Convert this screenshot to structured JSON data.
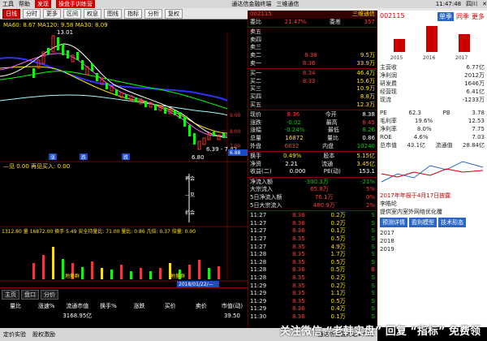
{
  "menubar": {
    "items": [
      "工具",
      "帮助",
      "发现",
      "操盘手训练营"
    ],
    "center": "通达信金融终端",
    "center2": "三维通信",
    "clock": "11:47:48",
    "region": "四川"
  },
  "toolbar": {
    "items": [
      "日线",
      "分时",
      "更多"
    ],
    "buttons": [
      "区间",
      "权息",
      "图线",
      "指标",
      "分析",
      "复权"
    ]
  },
  "chart": {
    "ma_line": "MA60: 8.67  MA120: 9.58    MA30: 8.09",
    "price_high": "13.01",
    "range_label": "6.39 - 7.42",
    "low_label": "6.80",
    "marker_labels": [
      "涨",
      "跌",
      "跌"
    ],
    "axis_labels": [
      "9.00",
      "8.00",
      "7.00",
      "6.88"
    ],
    "indicator_label": "—见  0.00  再见买入: 0.00",
    "indicator_marks": [
      "再会",
      "—见",
      "机会"
    ],
    "volume_line": "1312.80  量  16872.00  换手  5.49  安全持量比: 71.00  量比: 0.86   几倍: 0.37  倍量: 0.00",
    "bottom_labels": [
      "地量群",
      "地量群"
    ],
    "date_label": "2018/01/22/—"
  },
  "quote": {
    "code": "002115",
    "name": "三维通信",
    "weibi_label": "委比",
    "weibi": "21.47%",
    "weicha_label": "委差",
    "weicha": "357",
    "sell": [
      {
        "label": "卖五",
        "price": "",
        "vol": ""
      },
      {
        "label": "卖四",
        "price": "",
        "vol": ""
      },
      {
        "label": "卖三",
        "price": "",
        "vol": ""
      },
      {
        "label": "卖二",
        "price": "8.38",
        "vol": "9.5万"
      },
      {
        "label": "卖一",
        "price": "8.36",
        "vol": "33.9万"
      }
    ],
    "buy": [
      {
        "label": "买一",
        "price": "8.34",
        "vol": "46.4万"
      },
      {
        "label": "买二",
        "price": "8.33",
        "vol": "15.6万"
      },
      {
        "label": "买三",
        "price": "",
        "vol": "10.9万"
      },
      {
        "label": "买四",
        "price": "",
        "vol": "8.8万"
      },
      {
        "label": "买五",
        "price": "",
        "vol": "12.3万"
      }
    ],
    "stats": [
      {
        "l1": "现价",
        "v1": "8.36",
        "l2": "今开",
        "v2": "8.38"
      },
      {
        "l1": "涨跌",
        "v1": "-0.02",
        "l2": "最高",
        "v2": "8.45"
      },
      {
        "l1": "涨幅",
        "v1": "-0.24%",
        "l2": "最低",
        "v2": "8.26"
      },
      {
        "l1": "总量",
        "v1": "16872",
        "l2": "量比",
        "v2": "0.86"
      },
      {
        "l1": "外盘",
        "v1": "6632",
        "l2": "内盘",
        "v2": "10240"
      },
      {
        "l1": "换手",
        "v1": "0.49%",
        "l2": "股本",
        "v2": "5.15亿"
      },
      {
        "l1": "净资",
        "v1": "2.21",
        "l2": "流通",
        "v2": "3.45亿"
      },
      {
        "l1": "收益(二)",
        "v1": "0.000",
        "l2": "PE(动)",
        "v2": "153.1"
      }
    ],
    "flows": [
      {
        "l": "净流入额",
        "v": "-300.3万",
        "p": "-21%"
      },
      {
        "l": "大宗流入",
        "v": "65.8万",
        "p": "5%"
      },
      {
        "l": "5日净流入额",
        "v": "76.1万",
        "p": "0%"
      },
      {
        "l": "5日大宗流入",
        "v": "480.9万",
        "p": "2%"
      }
    ],
    "ticks": [
      {
        "t": "11:27",
        "p": "8.36",
        "v": "0.2万",
        "s": "S"
      },
      {
        "t": "11:27",
        "p": "8.36",
        "v": "0.2万",
        "s": "S"
      },
      {
        "t": "11:27",
        "p": "8.36",
        "v": "0.1万",
        "s": "S"
      },
      {
        "t": "11:27",
        "p": "8.35",
        "v": "0.5万",
        "s": "S"
      },
      {
        "t": "11:27",
        "p": "8.35",
        "v": "4.9万",
        "s": "S"
      },
      {
        "t": "11:28",
        "p": "8.35",
        "v": "1.7万",
        "s": "S"
      },
      {
        "t": "11:28",
        "p": "8.35",
        "v": "0.5万",
        "s": "S"
      },
      {
        "t": "11:28",
        "p": "8.36",
        "v": "0.5万",
        "s": "B"
      },
      {
        "t": "11:28",
        "p": "8.35",
        "v": "0.2万",
        "s": "S"
      },
      {
        "t": "11:29",
        "p": "8.35",
        "v": "0.2万",
        "s": "S"
      },
      {
        "t": "11:29",
        "p": "8.35",
        "v": "1.1万",
        "s": "S"
      },
      {
        "t": "11:29",
        "p": "8.35",
        "v": "0.5万",
        "s": "S"
      },
      {
        "t": "11:29",
        "p": "8.36",
        "v": "0.4万",
        "s": "S"
      },
      {
        "t": "11:30",
        "p": "8.36",
        "v": "0.1万",
        "s": "S"
      }
    ]
  },
  "info": {
    "code": "002115",
    "tabs": [
      "单季",
      "同季",
      "更多"
    ],
    "years": [
      "2015",
      "2016",
      "2017"
    ],
    "rows": [
      {
        "l": "主营收",
        "v": "6.77亿"
      },
      {
        "l": "净利润",
        "v": "2012万"
      },
      {
        "l": "研发费",
        "v": "1646万"
      },
      {
        "l": "经营现",
        "v": "6.41亿"
      },
      {
        "l": "现流",
        "v": "-1233万"
      }
    ],
    "metrics": [
      {
        "l": "PE",
        "v": "62.3",
        "l2": "PB",
        "v2": "3.78"
      },
      {
        "l": "毛利率",
        "v": "19.6%",
        "l2": "",
        "v2": "12.53"
      },
      {
        "l": "净利率",
        "v": "8.0%",
        "l2": "",
        "v2": "7.75"
      },
      {
        "l": "ROE",
        "v": "4.6%",
        "l2": "",
        "v2": "7.03"
      },
      {
        "l": "总市值",
        "v": "43.1亿",
        "l2": "流通值",
        "v2": "28.84亿"
      }
    ],
    "notice": "2017年年报于4月17日披露",
    "person": "李皓纶",
    "company": "提供室内室外网络优化覆",
    "bottom_tabs": [
      "预测详情",
      "盈利模型",
      "技术形态"
    ],
    "forecast_years": [
      "2017",
      "2018",
      "2019"
    ]
  },
  "bottom": {
    "headers": [
      "量比",
      "涨速%",
      "流通市值",
      "换手%",
      "涨跌",
      "买价",
      "卖价",
      "市值(动)"
    ],
    "values": [
      "",
      "",
      "3168.95亿",
      "",
      "",
      "",
      "",
      "39.50"
    ],
    "tabs": [
      "主页",
      "盘口",
      "分价"
    ]
  },
  "status": {
    "items": [
      "定价实验",
      "股权激励"
    ],
    "app": "通达信金融终端V7.32"
  },
  "watermark": "关注微信 “老韩实盘” 回复 “指标” 免费领"
}
